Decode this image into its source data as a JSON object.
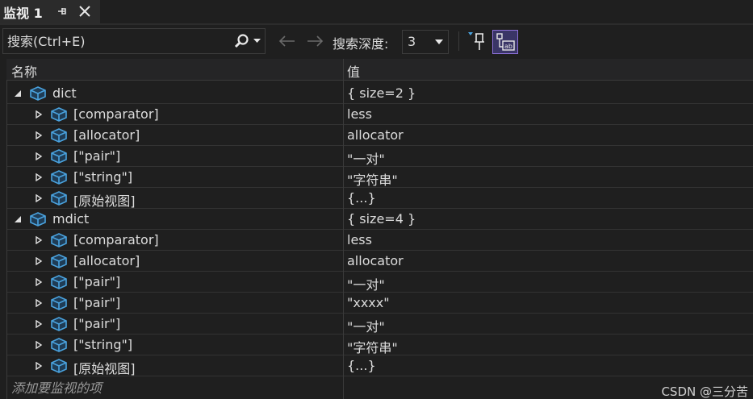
{
  "window": {
    "tab_title": "监视 1",
    "pin_icon": "pin-icon",
    "close_icon": "close-icon"
  },
  "toolbar": {
    "search_placeholder": "搜索(Ctrl+E)",
    "search_icon": "search-icon",
    "back_icon": "arrow-left-icon",
    "forward_icon": "arrow-right-icon",
    "depth_label": "搜索深度:",
    "depth_value": "3",
    "pin_button_icon": "pin-to-source-icon",
    "hex_button_icon": "hex-display-icon"
  },
  "grid": {
    "col_name": "名称",
    "col_value": "值",
    "rows": [
      {
        "name": "dict",
        "value": "{ size=2 }",
        "level": 0,
        "expanded": true
      },
      {
        "name": "[comparator]",
        "value": "less",
        "level": 1,
        "expanded": false
      },
      {
        "name": "[allocator]",
        "value": "allocator",
        "level": 1,
        "expanded": false
      },
      {
        "name": "[\"pair\"]",
        "value": "\"一对\"",
        "level": 1,
        "expanded": false
      },
      {
        "name": "[\"string\"]",
        "value": "\"字符串\"",
        "level": 1,
        "expanded": false
      },
      {
        "name": "[原始视图]",
        "value": "{...}",
        "level": 1,
        "expanded": false
      },
      {
        "name": "mdict",
        "value": "{ size=4 }",
        "level": 0,
        "expanded": true
      },
      {
        "name": "[comparator]",
        "value": "less",
        "level": 1,
        "expanded": false
      },
      {
        "name": "[allocator]",
        "value": "allocator",
        "level": 1,
        "expanded": false
      },
      {
        "name": "[\"pair\"]",
        "value": "\"一对\"",
        "level": 1,
        "expanded": false
      },
      {
        "name": "[\"pair\"]",
        "value": "\"xxxx\"",
        "level": 1,
        "expanded": false
      },
      {
        "name": "[\"pair\"]",
        "value": "\"一对\"",
        "level": 1,
        "expanded": false
      },
      {
        "name": "[\"string\"]",
        "value": "\"字符串\"",
        "level": 1,
        "expanded": false
      },
      {
        "name": "[原始视图]",
        "value": "{...}",
        "level": 1,
        "expanded": false
      }
    ],
    "add_item_text": "添加要监视的项"
  },
  "watermark": "CSDN @三分苦",
  "colors": {
    "background": "#1f1f1f",
    "icon_blue": "#4aa3df",
    "accent_purple": "#8b6fd6"
  }
}
